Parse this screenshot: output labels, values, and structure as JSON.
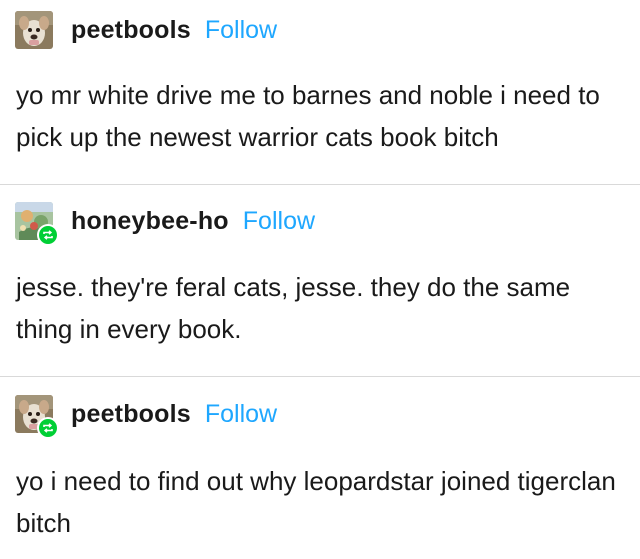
{
  "posts": [
    {
      "username": "peetbools",
      "follow_label": "Follow",
      "text": "yo mr white drive me to barnes and noble i need to pick up the newest warrior cats book bitch",
      "avatar": "dog-avatar-icon",
      "reblog": false
    },
    {
      "username": "honeybee-ho",
      "follow_label": "Follow",
      "text": "jesse. they're feral cats, jesse. they do the same thing in every book.",
      "avatar": "cat-art-avatar-icon",
      "reblog": true
    },
    {
      "username": "peetbools",
      "follow_label": "Follow",
      "text": "yo i need to find out why leopardstar joined tigerclan bitch",
      "avatar": "dog-avatar-icon",
      "reblog": true
    }
  ],
  "colors": {
    "follow": "#1ea7ff",
    "reblog_badge": "#00cf35",
    "divider": "#d9d9d9",
    "text": "#1a1a1a"
  }
}
